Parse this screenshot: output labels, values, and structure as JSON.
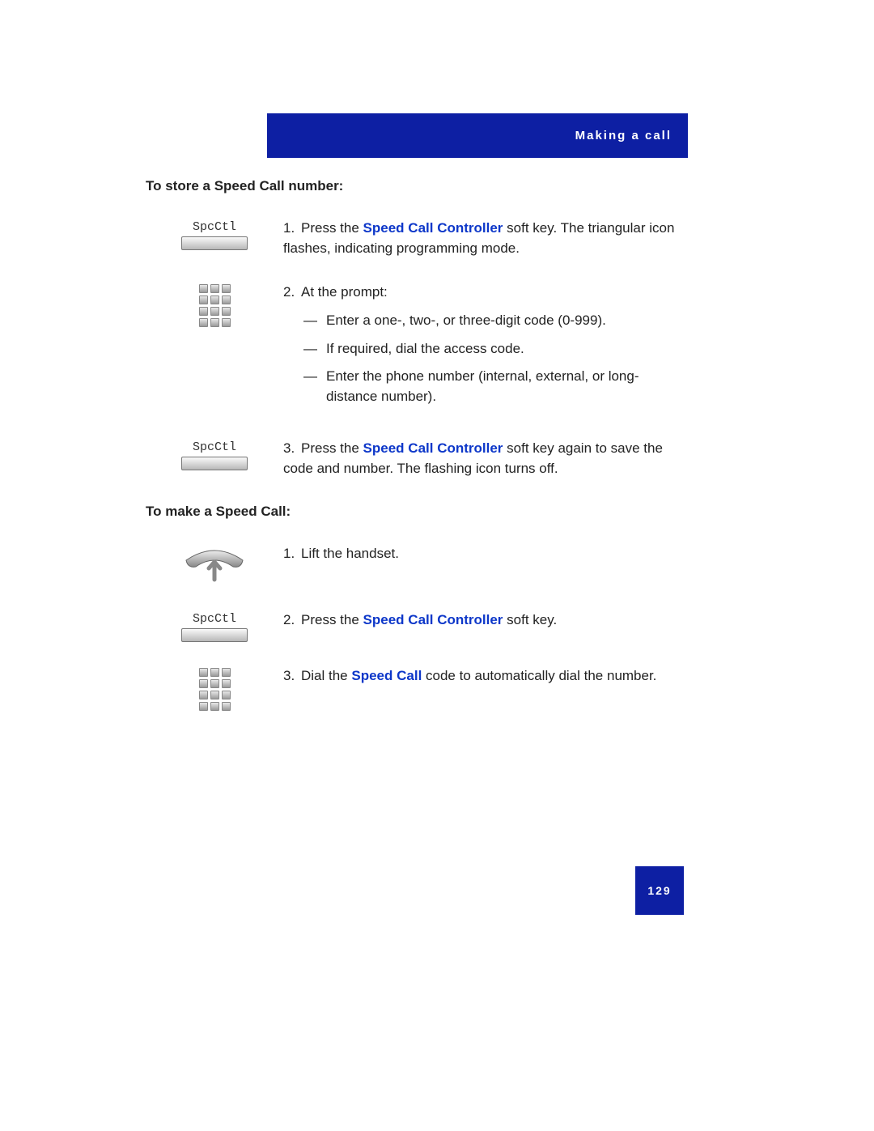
{
  "header": {
    "title": "Making a call"
  },
  "section1": {
    "title": "To store a Speed Call number:",
    "softkey_label": "SpcCtl",
    "step1_pre": "Press the ",
    "step1_em": "Speed Call Controller",
    "step1_post": " soft key. The triangular icon flashes, indicating programming mode.",
    "step2_intro": "At the prompt:",
    "step2_a": "Enter a one-, two-, or three-digit code (0-999).",
    "step2_b": "If required, dial the access code.",
    "step2_c": "Enter the phone number (internal, external, or long-distance number).",
    "step3_pre": "Press the ",
    "step3_em": "Speed Call Controller",
    "step3_post": " soft key again to save the code and number. The flashing icon turns off."
  },
  "section2": {
    "title": "To make a Speed Call:",
    "softkey_label": "SpcCtl",
    "step1": "Lift the handset.",
    "step2_pre": "Press the ",
    "step2_em": "Speed Call Controller",
    "step2_post": " soft key.",
    "step3_pre": "Dial the ",
    "step3_em": "Speed Call",
    "step3_post": " code to automatically dial the number."
  },
  "page_number": "129"
}
